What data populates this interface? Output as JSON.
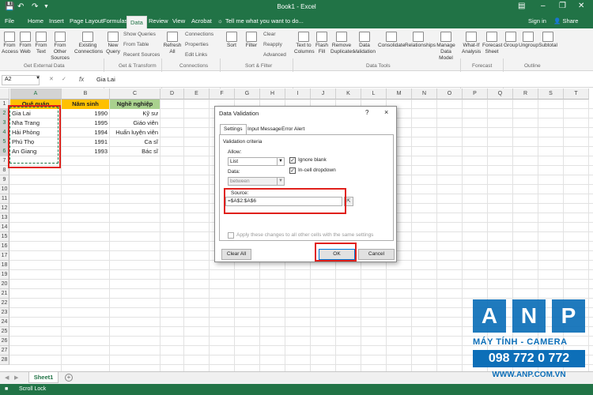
{
  "titlebar": {
    "title": "Book1 - Excel",
    "signin": "Sign in",
    "share": "Share"
  },
  "tabs": [
    "File",
    "Home",
    "Insert",
    "Page Layout",
    "Formulas",
    "Data",
    "Review",
    "View",
    "Acrobat"
  ],
  "tellme": "Tell me what you want to do...",
  "ribbon": {
    "get_external": [
      "From Access",
      "From Web",
      "From Text",
      "From Other Sources",
      "Existing Connections"
    ],
    "new_query": "New Query",
    "gt_small": [
      "Show Queries",
      "From Table",
      "Recent Sources"
    ],
    "refresh": "Refresh All",
    "conn_small": [
      "Connections",
      "Properties",
      "Edit Links"
    ],
    "sort": "Sort",
    "filter": "Filter",
    "filter_small": [
      "Clear",
      "Reapply",
      "Advanced"
    ],
    "tools": [
      "Text to Columns",
      "Flash Fill",
      "Remove Duplicates",
      "Data Validation",
      "Consolidate",
      "Relationships",
      "Manage Data Model"
    ],
    "forecast": [
      "What-If Analysis",
      "Forecast Sheet"
    ],
    "outline": [
      "Group",
      "Ungroup",
      "Subtotal"
    ],
    "groups": [
      "Get External Data",
      "Get & Transform",
      "Connections",
      "Sort & Filter",
      "Data Tools",
      "Forecast",
      "Outline"
    ]
  },
  "formula": {
    "namebox": "A2",
    "fx": "fx",
    "value": "Gia Lai"
  },
  "columns": [
    "A",
    "B",
    "C",
    "D",
    "E",
    "F",
    "G",
    "H",
    "I",
    "J",
    "K",
    "L",
    "M",
    "N",
    "O",
    "P",
    "Q",
    "R",
    "S",
    "T"
  ],
  "rows": [
    "1",
    "2",
    "3",
    "4",
    "5",
    "6",
    "7",
    "8",
    "9",
    "10",
    "11",
    "12",
    "13",
    "14",
    "15",
    "16",
    "17",
    "18",
    "19",
    "20",
    "21",
    "22",
    "23",
    "24",
    "25",
    "26",
    "27",
    "28"
  ],
  "headers": {
    "a": "Quê quán",
    "b": "Năm sinh",
    "c": "Nghề nghiệp"
  },
  "data": [
    {
      "a": "Gia Lai",
      "b": "1990",
      "c": "Kỹ sư"
    },
    {
      "a": "Nha Trang",
      "b": "1995",
      "c": "Giáo viên"
    },
    {
      "a": "Hải Phòng",
      "b": "1994",
      "c": "Huấn luyện viên"
    },
    {
      "a": "Phú Thọ",
      "b": "1991",
      "c": "Ca sĩ"
    },
    {
      "a": "An Giang",
      "b": "1993",
      "c": "Bác sĩ"
    }
  ],
  "dialog": {
    "title": "Data Validation",
    "help": "?",
    "close": "×",
    "tabs": [
      "Settings",
      "Input Message",
      "Error Alert"
    ],
    "criteria": "Validation criteria",
    "allow_label": "Allow:",
    "allow_value": "List",
    "data_label": "Data:",
    "data_value": "between",
    "ignore_blank": "Ignore blank",
    "incell": "In-cell dropdown",
    "source_label": "Source:",
    "source_value": "=$A$2:$A$6",
    "apply_all": "Apply these changes to all other cells with the same settings",
    "clear_all": "Clear All",
    "ok": "OK",
    "cancel": "Cancel"
  },
  "sheet": {
    "name": "Sheet1",
    "add": "+"
  },
  "status": {
    "text": "Scroll Lock"
  },
  "watermark": {
    "letters": [
      "A",
      "N",
      "P"
    ],
    "line1": "MÁY TÍNH - CAMERA",
    "line2": "098 772 0 772",
    "line3": "WWW.ANP.COM.VN"
  }
}
